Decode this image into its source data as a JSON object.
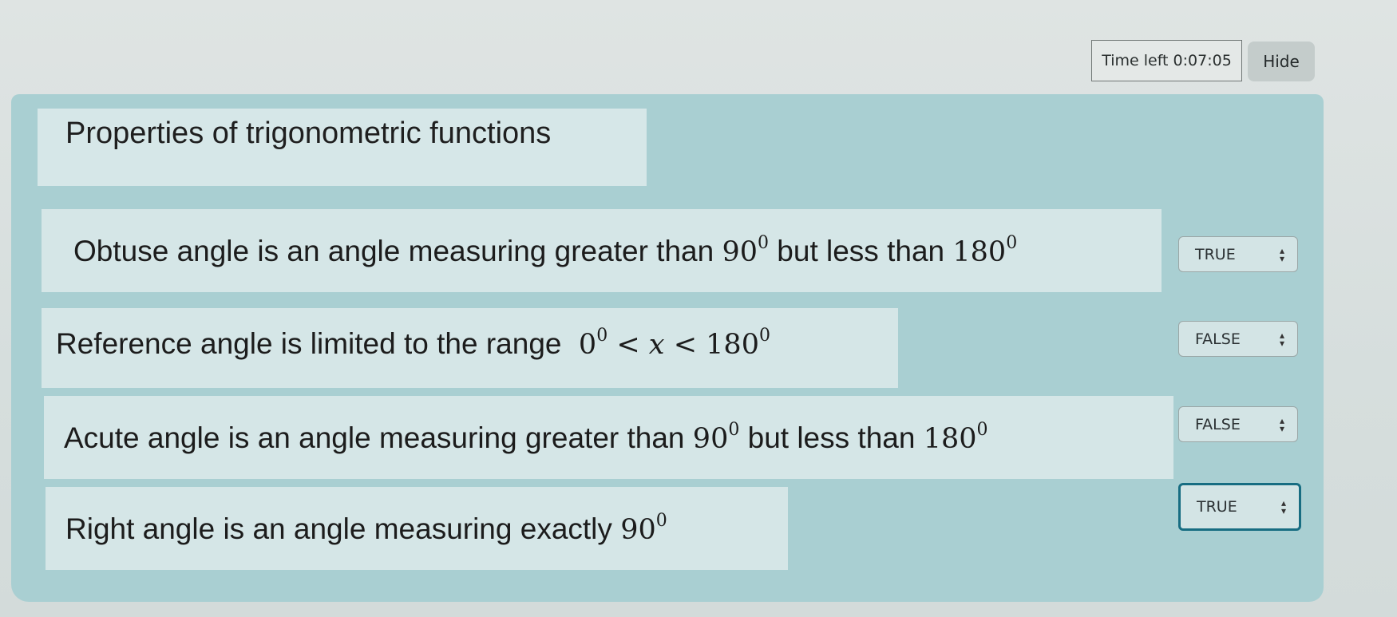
{
  "timer": {
    "label": "Time left",
    "value": "0:07:05"
  },
  "hide_button": "Hide",
  "question_title": "Properties of trigonometric functions",
  "statements": [
    {
      "text": "Obtuse angle is an angle measuring greater than",
      "math1": "90",
      "mid": "but less than",
      "math2": "180",
      "sup": "0",
      "answer": "TRUE"
    },
    {
      "text": "Reference angle is limited to the range",
      "math_a": "0",
      "lt": "<",
      "var": "x",
      "math_b": "180",
      "sup": "0",
      "answer": "FALSE"
    },
    {
      "text": "Acute angle is an angle measuring greater than",
      "math1": "90",
      "mid": "but less than",
      "math2": "180",
      "sup": "0",
      "answer": "FALSE"
    },
    {
      "text": "Right angle is an angle measuring exactly",
      "math1": "90",
      "sup": "0",
      "answer": "TRUE"
    }
  ],
  "colors": {
    "panel": "#a9cfd2",
    "focus_border": "#176d82"
  },
  "icons": {
    "select_arrow": "updown-chevron-icon"
  }
}
